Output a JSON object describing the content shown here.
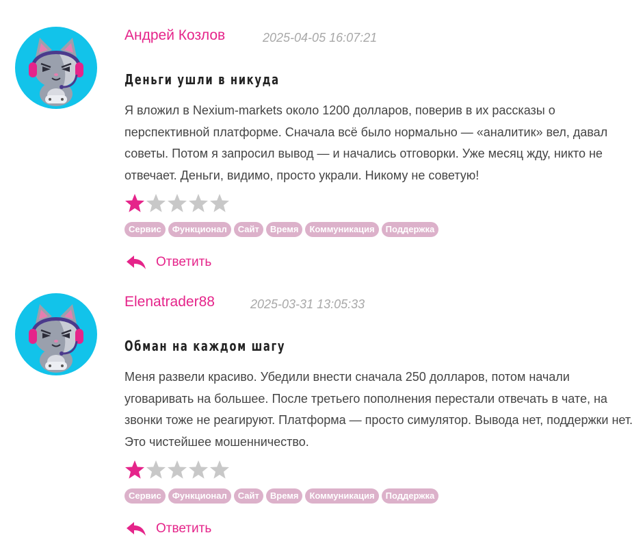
{
  "colors": {
    "accent": "#e5248a",
    "tag_bg": "#dcb1ca",
    "star_empty": "#c8c8c8",
    "avatar_bg": "#12c3ea"
  },
  "reviews": [
    {
      "author": "Андрей Козлов",
      "date": "2025-04-05 16:07:21",
      "title": "Деньги ушли в никуда",
      "body": "Я вложил в Nexium-markets около 1200 долларов, поверив в их рассказы о перспективной платформе. Сначала всё было нормально — «аналитик» вел, давал советы. Потом я запросил вывод — и начались отговорки. Уже месяц жду, никто не отвечает. Деньги, видимо, просто украли. Никому не советую!",
      "rating": 1,
      "rating_max": 5,
      "tags": [
        "Сервис",
        "Функционал",
        "Сайт",
        "Время",
        "Коммуникация",
        "Поддержка"
      ],
      "reply_label": "Ответить",
      "avatar_icon": "cat-gamer-headset-avatar"
    },
    {
      "author": "Elenatrader88",
      "date": "2025-03-31 13:05:33",
      "title": "Обман на каждом шагу",
      "body": "Меня развели красиво. Убедили внести сначала 250 долларов, потом начали уговаривать на большее. После третьего пополнения перестали отвечать в чате, на звонки тоже не реагируют. Платформа — просто симулятор. Вывода нет, поддержки нет. Это чистейшее мошенничество.",
      "rating": 1,
      "rating_max": 5,
      "tags": [
        "Сервис",
        "Функционал",
        "Сайт",
        "Время",
        "Коммуникация",
        "Поддержка"
      ],
      "reply_label": "Ответить",
      "avatar_icon": "cat-gamer-headset-avatar"
    }
  ]
}
